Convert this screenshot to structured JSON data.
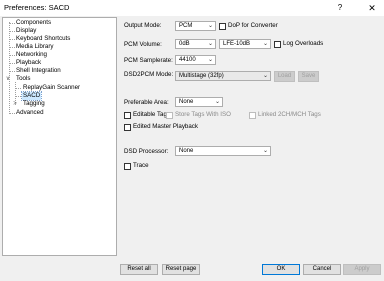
{
  "window": {
    "title": "Preferences: SACD",
    "help_label": "?",
    "close_label": "✕"
  },
  "tree": {
    "items": [
      {
        "label": "Components"
      },
      {
        "label": "Display"
      },
      {
        "label": "Keyboard Shortcuts"
      },
      {
        "label": "Media Library"
      },
      {
        "label": "Networking"
      },
      {
        "label": "Playback"
      },
      {
        "label": "Shell Integration"
      },
      {
        "label": "Tools"
      },
      {
        "label": "ReplayGain Scanner"
      },
      {
        "label": "SACD"
      },
      {
        "label": "Tagging"
      },
      {
        "label": "Advanced"
      }
    ],
    "expander_open": "∨",
    "expander_closed": ">"
  },
  "settings": {
    "output_mode": {
      "label": "Output Mode:",
      "value": "PCM"
    },
    "dop_label": "DoP for Converter",
    "pcm_volume": {
      "label": "PCM Volume:",
      "value": "0dB"
    },
    "lfe_value": "LFE-10dB",
    "log_overloads_label": "Log Overloads",
    "pcm_samplerate": {
      "label": "PCM Samplerate:",
      "value": "44100"
    },
    "dsd2pcm_mode": {
      "label": "DSD2PCM Mode:",
      "value": "Multistage (32fp)"
    },
    "load_label": "Load",
    "save_label": "Save",
    "preferable_area": {
      "label": "Preferable Area:",
      "value": "None"
    },
    "editable_tags_label": "Editable Tags",
    "store_tags_label": "Store Tags With ISO",
    "linked_label": "Linked 2CH/MCH Tags",
    "edited_master_label": "Edited Master Playback",
    "dsd_processor": {
      "label": "DSD Processor:",
      "value": "None"
    },
    "trace_label": "Trace"
  },
  "footer": {
    "reset_all": "Reset all",
    "reset_page": "Reset page",
    "ok": "OK",
    "cancel": "Cancel",
    "apply": "Apply"
  },
  "combo_arrow": "⌄"
}
